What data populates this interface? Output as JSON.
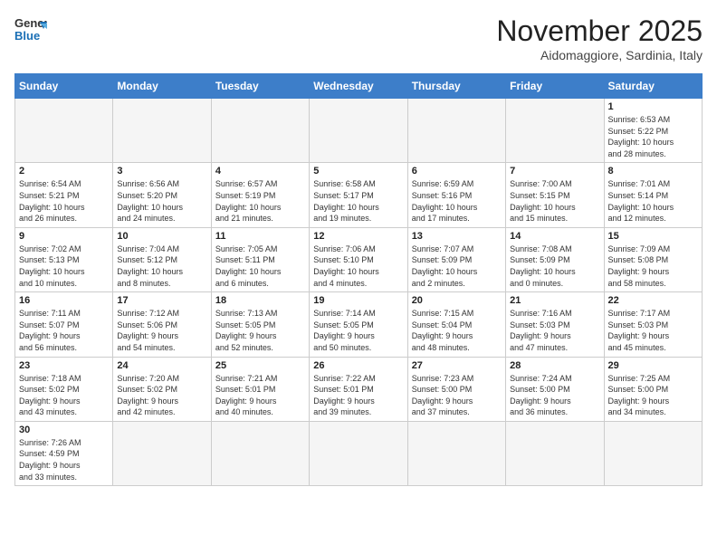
{
  "header": {
    "logo_general": "General",
    "logo_blue": "Blue",
    "title": "November 2025",
    "location": "Aidomaggiore, Sardinia, Italy"
  },
  "days_of_week": [
    "Sunday",
    "Monday",
    "Tuesday",
    "Wednesday",
    "Thursday",
    "Friday",
    "Saturday"
  ],
  "weeks": [
    [
      {
        "day": "",
        "info": ""
      },
      {
        "day": "",
        "info": ""
      },
      {
        "day": "",
        "info": ""
      },
      {
        "day": "",
        "info": ""
      },
      {
        "day": "",
        "info": ""
      },
      {
        "day": "",
        "info": ""
      },
      {
        "day": "1",
        "info": "Sunrise: 6:53 AM\nSunset: 5:22 PM\nDaylight: 10 hours\nand 28 minutes."
      }
    ],
    [
      {
        "day": "2",
        "info": "Sunrise: 6:54 AM\nSunset: 5:21 PM\nDaylight: 10 hours\nand 26 minutes."
      },
      {
        "day": "3",
        "info": "Sunrise: 6:56 AM\nSunset: 5:20 PM\nDaylight: 10 hours\nand 24 minutes."
      },
      {
        "day": "4",
        "info": "Sunrise: 6:57 AM\nSunset: 5:19 PM\nDaylight: 10 hours\nand 21 minutes."
      },
      {
        "day": "5",
        "info": "Sunrise: 6:58 AM\nSunset: 5:17 PM\nDaylight: 10 hours\nand 19 minutes."
      },
      {
        "day": "6",
        "info": "Sunrise: 6:59 AM\nSunset: 5:16 PM\nDaylight: 10 hours\nand 17 minutes."
      },
      {
        "day": "7",
        "info": "Sunrise: 7:00 AM\nSunset: 5:15 PM\nDaylight: 10 hours\nand 15 minutes."
      },
      {
        "day": "8",
        "info": "Sunrise: 7:01 AM\nSunset: 5:14 PM\nDaylight: 10 hours\nand 12 minutes."
      }
    ],
    [
      {
        "day": "9",
        "info": "Sunrise: 7:02 AM\nSunset: 5:13 PM\nDaylight: 10 hours\nand 10 minutes."
      },
      {
        "day": "10",
        "info": "Sunrise: 7:04 AM\nSunset: 5:12 PM\nDaylight: 10 hours\nand 8 minutes."
      },
      {
        "day": "11",
        "info": "Sunrise: 7:05 AM\nSunset: 5:11 PM\nDaylight: 10 hours\nand 6 minutes."
      },
      {
        "day": "12",
        "info": "Sunrise: 7:06 AM\nSunset: 5:10 PM\nDaylight: 10 hours\nand 4 minutes."
      },
      {
        "day": "13",
        "info": "Sunrise: 7:07 AM\nSunset: 5:09 PM\nDaylight: 10 hours\nand 2 minutes."
      },
      {
        "day": "14",
        "info": "Sunrise: 7:08 AM\nSunset: 5:09 PM\nDaylight: 10 hours\nand 0 minutes."
      },
      {
        "day": "15",
        "info": "Sunrise: 7:09 AM\nSunset: 5:08 PM\nDaylight: 9 hours\nand 58 minutes."
      }
    ],
    [
      {
        "day": "16",
        "info": "Sunrise: 7:11 AM\nSunset: 5:07 PM\nDaylight: 9 hours\nand 56 minutes."
      },
      {
        "day": "17",
        "info": "Sunrise: 7:12 AM\nSunset: 5:06 PM\nDaylight: 9 hours\nand 54 minutes."
      },
      {
        "day": "18",
        "info": "Sunrise: 7:13 AM\nSunset: 5:05 PM\nDaylight: 9 hours\nand 52 minutes."
      },
      {
        "day": "19",
        "info": "Sunrise: 7:14 AM\nSunset: 5:05 PM\nDaylight: 9 hours\nand 50 minutes."
      },
      {
        "day": "20",
        "info": "Sunrise: 7:15 AM\nSunset: 5:04 PM\nDaylight: 9 hours\nand 48 minutes."
      },
      {
        "day": "21",
        "info": "Sunrise: 7:16 AM\nSunset: 5:03 PM\nDaylight: 9 hours\nand 47 minutes."
      },
      {
        "day": "22",
        "info": "Sunrise: 7:17 AM\nSunset: 5:03 PM\nDaylight: 9 hours\nand 45 minutes."
      }
    ],
    [
      {
        "day": "23",
        "info": "Sunrise: 7:18 AM\nSunset: 5:02 PM\nDaylight: 9 hours\nand 43 minutes."
      },
      {
        "day": "24",
        "info": "Sunrise: 7:20 AM\nSunset: 5:02 PM\nDaylight: 9 hours\nand 42 minutes."
      },
      {
        "day": "25",
        "info": "Sunrise: 7:21 AM\nSunset: 5:01 PM\nDaylight: 9 hours\nand 40 minutes."
      },
      {
        "day": "26",
        "info": "Sunrise: 7:22 AM\nSunset: 5:01 PM\nDaylight: 9 hours\nand 39 minutes."
      },
      {
        "day": "27",
        "info": "Sunrise: 7:23 AM\nSunset: 5:00 PM\nDaylight: 9 hours\nand 37 minutes."
      },
      {
        "day": "28",
        "info": "Sunrise: 7:24 AM\nSunset: 5:00 PM\nDaylight: 9 hours\nand 36 minutes."
      },
      {
        "day": "29",
        "info": "Sunrise: 7:25 AM\nSunset: 5:00 PM\nDaylight: 9 hours\nand 34 minutes."
      }
    ],
    [
      {
        "day": "30",
        "info": "Sunrise: 7:26 AM\nSunset: 4:59 PM\nDaylight: 9 hours\nand 33 minutes."
      },
      {
        "day": "",
        "info": ""
      },
      {
        "day": "",
        "info": ""
      },
      {
        "day": "",
        "info": ""
      },
      {
        "day": "",
        "info": ""
      },
      {
        "day": "",
        "info": ""
      },
      {
        "day": "",
        "info": ""
      }
    ]
  ]
}
